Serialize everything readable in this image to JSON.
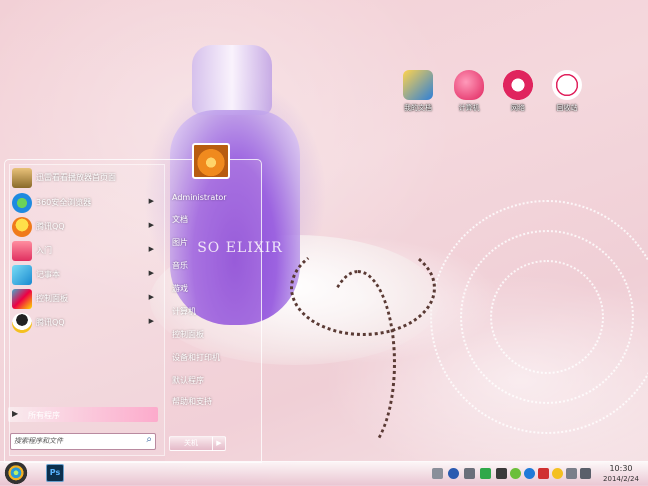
{
  "desktop": {
    "icons": [
      {
        "label": "我的文档",
        "icon": "documents-folder-icon"
      },
      {
        "label": "计算机",
        "icon": "computer-heart-icon"
      },
      {
        "label": "网络",
        "icon": "network-heart-icon"
      },
      {
        "label": "回收站",
        "icon": "recycle-bin-heart-icon"
      }
    ],
    "wallpaper_text": "SO ELIXIR"
  },
  "start_menu": {
    "programs": [
      {
        "label": "迅雷看看播放器首页面",
        "icon": "media-player-icon",
        "has_arrow": false
      },
      {
        "label": "360安全浏览器",
        "icon": "browser-icon",
        "has_arrow": true
      },
      {
        "label": "腾讯QQ",
        "icon": "qq-icon",
        "has_arrow": true
      },
      {
        "label": "入门",
        "icon": "getting-started-icon",
        "has_arrow": true
      },
      {
        "label": "记事本",
        "icon": "notepad-icon",
        "has_arrow": true
      },
      {
        "label": "控制面板",
        "icon": "control-panel-icon",
        "has_arrow": true
      },
      {
        "label": "腾讯QQ",
        "icon": "qq-penguin-icon",
        "has_arrow": true
      }
    ],
    "all_programs": "所有程序",
    "search_placeholder": "搜索程序和文件",
    "right_items": [
      "Administrator",
      "文档",
      "图片",
      "音乐",
      "游戏",
      "计算机",
      "控制面板",
      "设备和打印机",
      "默认程序",
      "帮助和支持"
    ],
    "shutdown_label": "关机",
    "shutdown_arrow": "▶"
  },
  "taskbar": {
    "pinned": [
      {
        "label": "Ps",
        "icon": "photoshop-icon"
      }
    ],
    "time": "10:30",
    "date": "2014/2/24",
    "colors": {
      "accent": "#f0a0c0"
    }
  }
}
